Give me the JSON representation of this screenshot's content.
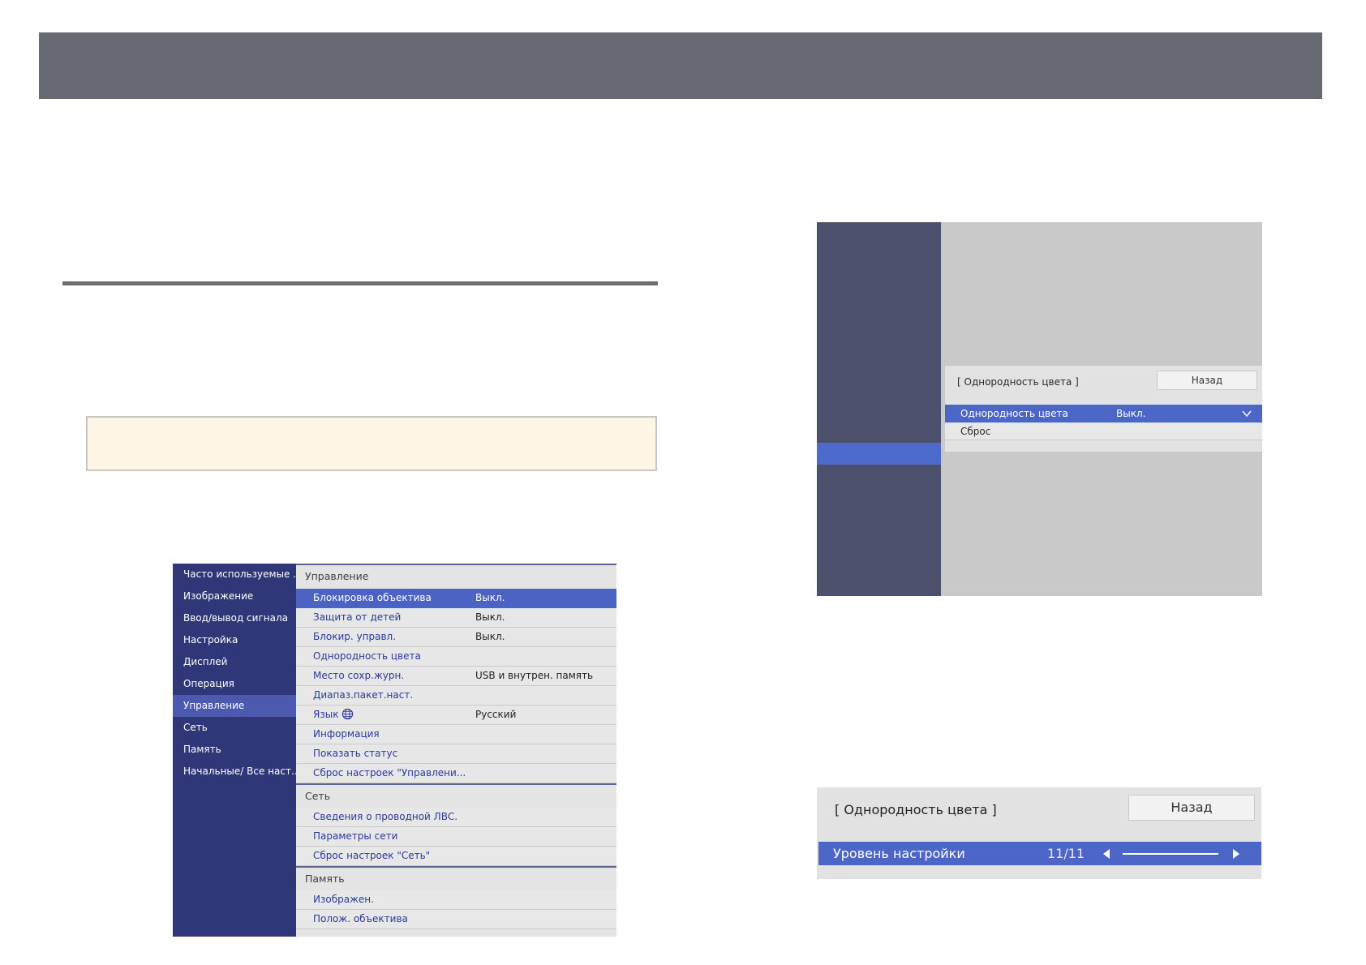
{
  "menu": {
    "nav": [
      "Часто используемые ...",
      "Изображение",
      "Ввод/вывод сигнала",
      "Настройка",
      "Дисплей",
      "Операция",
      "Управление",
      "Сеть",
      "Память",
      "Начальные/ Все наст..."
    ],
    "sections": [
      {
        "title": "Управление",
        "rows": [
          {
            "label": "Блокировка объектива",
            "value": "Выкл."
          },
          {
            "label": "Защита от детей",
            "value": "Выкл."
          },
          {
            "label": "Блокир. управл.",
            "value": "Выкл."
          },
          {
            "label": "Однородность цвета",
            "value": ""
          },
          {
            "label": "Место сохр.журн.",
            "value": "USB и внутрен. память"
          },
          {
            "label": "Диапаз.пакет.наст.",
            "value": ""
          },
          {
            "label": "Язык",
            "value": "Русский"
          },
          {
            "label": "Информация",
            "value": ""
          },
          {
            "label": "Показать статус",
            "value": ""
          },
          {
            "label": "Сброс настроек \"Управлени...",
            "value": ""
          }
        ]
      },
      {
        "title": "Сеть",
        "rows": [
          {
            "label": "Сведения о проводной ЛВС.",
            "value": ""
          },
          {
            "label": "Параметры сети",
            "value": ""
          },
          {
            "label": "Сброс настроек \"Сеть\"",
            "value": ""
          }
        ]
      },
      {
        "title": "Память",
        "rows": [
          {
            "label": "Изображен.",
            "value": ""
          },
          {
            "label": "Полож. объектива",
            "value": ""
          }
        ]
      }
    ]
  },
  "uniformity": {
    "title": "[ Однородность цвета ]",
    "back": "Назад",
    "rows": [
      {
        "label": "Однородность цвета",
        "value": "Выкл."
      },
      {
        "label": "Сброс",
        "value": ""
      }
    ]
  },
  "adjust": {
    "title": "[ Однородность цвета ]",
    "back": "Назад",
    "label": "Уровень настройки",
    "value": "11/11",
    "level": 1.0
  },
  "icons": [
    "globe-icon",
    "chevron-down-icon",
    "arrow-left-icon",
    "arrow-right-icon"
  ],
  "colors": {
    "nav_bg": "#2f3778",
    "nav_active": "#4b5aaf",
    "selection": "#4c63c4",
    "header_bar": "#676a73",
    "note_bg": "#fdf6e7"
  }
}
